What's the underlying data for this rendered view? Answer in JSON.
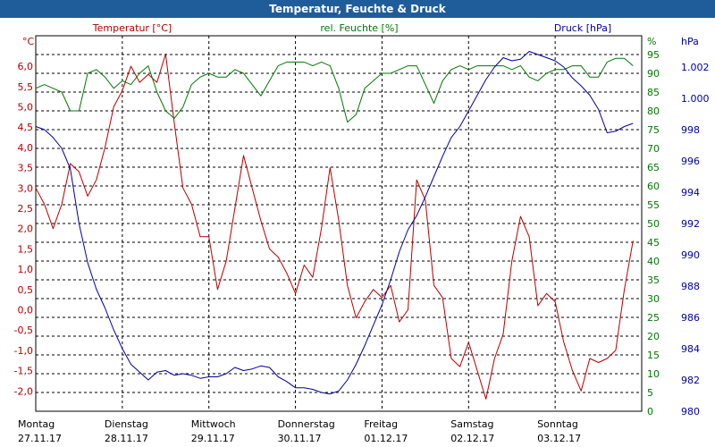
{
  "window": {
    "title": "Temperatur, Feuchte & Druck"
  },
  "colors": {
    "temperature": "#b40000",
    "humidity": "#007800",
    "pressure": "#0000a0",
    "grid": "#000000",
    "titlebar": "#1f5d9a"
  },
  "chart_data": {
    "type": "line",
    "title": "Temperatur, Feuchte & Druck",
    "grid": true,
    "x_range": [
      0,
      7
    ],
    "x_ticks": [
      {
        "x": 0,
        "day": "Montag",
        "date": "27.11.17"
      },
      {
        "x": 1,
        "day": "Dienstag",
        "date": "28.11.17"
      },
      {
        "x": 2,
        "day": "Mittwoch",
        "date": "29.11.17"
      },
      {
        "x": 3,
        "day": "Donnerstag",
        "date": "30.11.17"
      },
      {
        "x": 4,
        "day": "Freitag",
        "date": "01.12.17"
      },
      {
        "x": 5,
        "day": "Samstag",
        "date": "02.12.17"
      },
      {
        "x": 6,
        "day": "Sonntag",
        "date": "03.12.17"
      }
    ],
    "axes": {
      "temperature": {
        "label": "Temperatur [°C]",
        "unit": "°C",
        "range": [
          -2.5,
          6.75
        ],
        "ticks": [
          "6,0",
          "5,5",
          "5,0",
          "4,5",
          "4,0",
          "3,5",
          "3,0",
          "2,5",
          "2,0",
          "1,5",
          "1,0",
          "0,5",
          "0,0",
          "-0,5",
          "-1,0",
          "-1,5",
          "-2,0"
        ]
      },
      "humidity": {
        "label": "rel. Feuchte [%]",
        "unit": "%",
        "range": [
          0,
          100
        ],
        "ticks": [
          "95",
          "90",
          "85",
          "80",
          "75",
          "70",
          "65",
          "60",
          "55",
          "50",
          "45",
          "40",
          "35",
          "30",
          "25",
          "20",
          "15",
          "10",
          "5",
          "0"
        ]
      },
      "pressure": {
        "label": "Druck [hPa]",
        "unit": "hPa",
        "range": [
          980,
          1004
        ],
        "ticks": [
          "1.002",
          "1.000",
          "998",
          "996",
          "994",
          "992",
          "990",
          "988",
          "986",
          "984",
          "982",
          "980"
        ]
      }
    },
    "series": [
      {
        "name": "Temperatur [°C]",
        "axis": "temperature",
        "x": [
          0.0,
          0.1,
          0.2,
          0.3,
          0.4,
          0.5,
          0.6,
          0.7,
          0.8,
          0.9,
          1.0,
          1.1,
          1.2,
          1.3,
          1.4,
          1.5,
          1.6,
          1.7,
          1.8,
          1.9,
          2.0,
          2.1,
          2.2,
          2.3,
          2.4,
          2.5,
          2.6,
          2.7,
          2.8,
          2.9,
          3.0,
          3.1,
          3.2,
          3.3,
          3.4,
          3.5,
          3.6,
          3.7,
          3.8,
          3.9,
          4.0,
          4.1,
          4.2,
          4.3,
          4.4,
          4.5,
          4.6,
          4.7,
          4.8,
          4.9,
          5.0,
          5.1,
          5.2,
          5.3,
          5.4,
          5.5,
          5.6,
          5.7,
          5.8,
          5.9,
          6.0,
          6.1,
          6.2,
          6.3,
          6.4,
          6.5,
          6.6,
          6.7,
          6.8,
          6.9
        ],
        "values": [
          3.0,
          2.6,
          2.0,
          2.6,
          3.6,
          3.4,
          2.8,
          3.2,
          4.0,
          5.0,
          5.4,
          6.0,
          5.6,
          5.8,
          5.6,
          6.3,
          4.6,
          3.0,
          2.6,
          1.8,
          1.8,
          0.5,
          1.2,
          2.5,
          3.8,
          3.0,
          2.2,
          1.5,
          1.3,
          0.9,
          0.4,
          1.1,
          0.8,
          2.0,
          3.5,
          2.2,
          0.6,
          -0.2,
          0.2,
          0.5,
          0.3,
          0.6,
          -0.3,
          0.0,
          3.2,
          2.7,
          0.6,
          0.3,
          -1.2,
          -1.4,
          -0.8,
          -1.5,
          -2.2,
          -1.2,
          -0.6,
          1.2,
          2.3,
          1.8,
          0.1,
          0.4,
          0.2,
          -0.8,
          -1.5,
          -2.0,
          -1.2,
          -1.3,
          -1.2,
          -1.0,
          0.5,
          1.7
        ]
      },
      {
        "name": "rel. Feuchte [%]",
        "axis": "humidity",
        "x": [
          0.0,
          0.1,
          0.2,
          0.3,
          0.4,
          0.5,
          0.6,
          0.7,
          0.8,
          0.9,
          1.0,
          1.1,
          1.2,
          1.3,
          1.4,
          1.5,
          1.6,
          1.7,
          1.8,
          1.9,
          2.0,
          2.1,
          2.2,
          2.3,
          2.4,
          2.5,
          2.6,
          2.7,
          2.8,
          2.9,
          3.0,
          3.1,
          3.2,
          3.3,
          3.4,
          3.5,
          3.6,
          3.7,
          3.8,
          3.9,
          4.0,
          4.1,
          4.2,
          4.3,
          4.4,
          4.5,
          4.6,
          4.7,
          4.8,
          4.9,
          5.0,
          5.1,
          5.2,
          5.3,
          5.4,
          5.5,
          5.6,
          5.7,
          5.8,
          5.9,
          6.0,
          6.1,
          6.2,
          6.3,
          6.4,
          6.5,
          6.6,
          6.7,
          6.8,
          6.9
        ],
        "values": [
          86,
          87,
          86,
          85,
          80,
          80,
          90,
          91,
          89,
          86,
          88,
          87,
          90,
          92,
          85,
          80,
          78,
          81,
          87,
          89,
          90,
          89,
          89,
          91,
          90,
          87,
          84,
          88,
          92,
          93,
          93,
          93,
          92,
          93,
          92,
          86,
          77,
          79,
          86,
          88,
          90,
          90,
          91,
          92,
          92,
          87,
          82,
          88,
          91,
          92,
          91,
          92,
          92,
          92,
          92,
          91,
          92,
          89,
          88,
          90,
          91,
          91,
          92,
          92,
          89,
          89,
          93,
          94,
          94,
          92
        ]
      },
      {
        "name": "Druck [hPa]",
        "axis": "pressure",
        "x": [
          0.0,
          0.1,
          0.2,
          0.3,
          0.4,
          0.5,
          0.6,
          0.7,
          0.8,
          0.9,
          1.0,
          1.1,
          1.2,
          1.3,
          1.4,
          1.5,
          1.6,
          1.7,
          1.8,
          1.9,
          2.0,
          2.1,
          2.2,
          2.3,
          2.4,
          2.5,
          2.6,
          2.7,
          2.8,
          2.9,
          3.0,
          3.1,
          3.2,
          3.3,
          3.4,
          3.5,
          3.6,
          3.7,
          3.8,
          3.9,
          4.0,
          4.1,
          4.2,
          4.3,
          4.4,
          4.5,
          4.6,
          4.7,
          4.8,
          4.9,
          5.0,
          5.1,
          5.2,
          5.3,
          5.4,
          5.5,
          5.6,
          5.7,
          5.8,
          5.9,
          6.0,
          6.1,
          6.2,
          6.3,
          6.4,
          6.5,
          6.6,
          6.7,
          6.8,
          6.9
        ],
        "values": [
          998.2,
          998.0,
          997.5,
          996.8,
          995.5,
          992.0,
          989.5,
          987.8,
          986.6,
          985.2,
          984.0,
          983.0,
          982.5,
          982.0,
          982.5,
          982.6,
          982.3,
          982.4,
          982.3,
          982.1,
          982.2,
          982.2,
          982.4,
          982.8,
          982.6,
          982.7,
          982.9,
          982.8,
          982.2,
          981.9,
          981.5,
          981.5,
          981.4,
          981.2,
          981.1,
          981.3,
          982.0,
          983.0,
          984.2,
          985.5,
          986.8,
          988.4,
          990.2,
          991.6,
          992.5,
          993.7,
          995.0,
          996.3,
          997.5,
          998.2,
          999.2,
          1000.2,
          1001.2,
          1002.0,
          1002.6,
          1002.4,
          1002.5,
          1003.0,
          1002.8,
          1002.6,
          1002.4,
          1002.0,
          1001.3,
          1000.8,
          1000.2,
          999.3,
          997.8,
          997.9,
          998.2,
          998.4
        ]
      }
    ]
  }
}
